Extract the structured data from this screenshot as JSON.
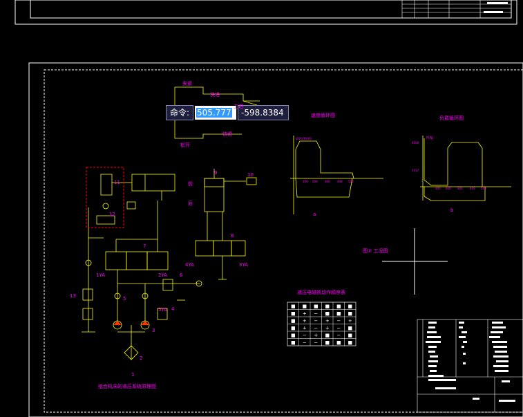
{
  "command": {
    "label": "命令:",
    "x_value": "505.777",
    "y_value": "-598.8384"
  },
  "labels": {
    "valve_top": "夹紧",
    "valve_mid1": "快进",
    "valve_mid2": "工进",
    "valve_bot": "快退",
    "valve_left": "松开",
    "speed_chart_title": "速度循环图",
    "speed_y": "v(m/min)",
    "speed_sub": "a",
    "load_chart_title": "负载循环图",
    "load_y": "F(N)",
    "load_sub": "b",
    "cycle_title": "图② 工况图",
    "system_title": "组合机床的液压系统原理图",
    "solenoid_table_title": "液压电磁铁动作顺序表",
    "cyl_front": "前",
    "cyl_back": "后",
    "n1": "1",
    "n2": "2",
    "n3": "3",
    "n4": "4",
    "n5": "5",
    "n6": "6",
    "n7": "7",
    "n8": "8",
    "n9": "9",
    "n10": "10",
    "n11": "11",
    "n12": "12",
    "n13": "13",
    "ya1": "1YA",
    "ya2": "2YA",
    "ya3": "3YA",
    "ya4": "4YA",
    "ya5": "5YA"
  },
  "solenoid_table": [
    [
      "■",
      "■",
      "■",
      "■",
      "■",
      "■"
    ],
    [
      "■",
      "+",
      "−",
      "■",
      "■",
      "■"
    ],
    [
      "■",
      "+",
      "−",
      "+",
      "−",
      "+"
    ],
    [
      "■",
      "+",
      "−",
      "+",
      "−",
      "■"
    ],
    [
      "■",
      "−",
      "+",
      "■",
      "−",
      "■"
    ],
    [
      "■",
      "−",
      "−",
      "■",
      "■",
      "■"
    ]
  ]
}
